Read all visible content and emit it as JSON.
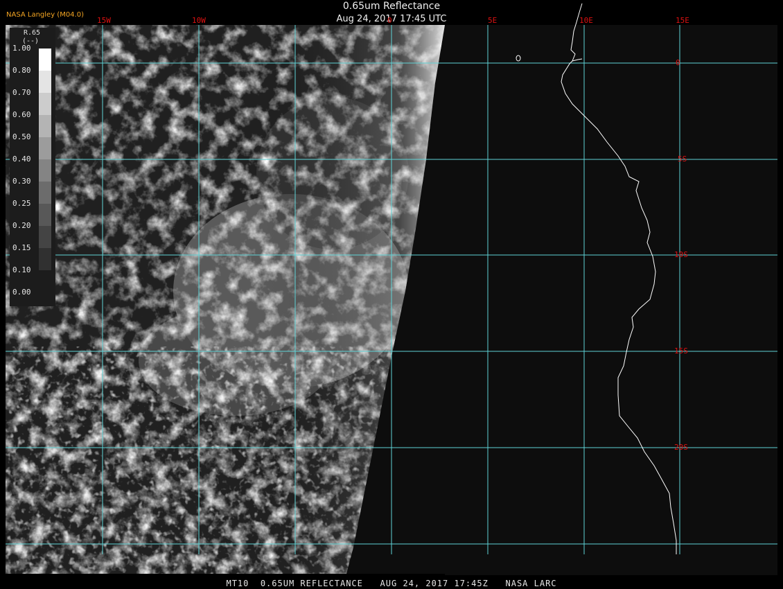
{
  "header": {
    "title": "0.65um Reflectance",
    "subtitle": "Aug 24, 2017 17:45 UTC",
    "org_label": "NASA Langley (M04.0)"
  },
  "legend": {
    "variable": "R.65",
    "unit": "(--)",
    "ticks": [
      "1.00",
      "0.80",
      "0.70",
      "0.60",
      "0.50",
      "0.40",
      "0.30",
      "0.25",
      "0.20",
      "0.15",
      "0.10",
      "0.00"
    ],
    "colors": [
      "#ffffff",
      "#e4e4e4",
      "#cccccc",
      "#b4b4b4",
      "#9c9c9c",
      "#848484",
      "#6c6c6c",
      "#585858",
      "#444444",
      "#303030",
      "#1c1c1c"
    ]
  },
  "grid": {
    "longitudes": [
      "15W",
      "10W",
      "0",
      "5E",
      "10E",
      "15E"
    ],
    "latitudes": [
      "0",
      "5S",
      "10S",
      "15S",
      "20S"
    ]
  },
  "footer": {
    "text": "MT10  0.65UM REFLECTANCE   AUG 24, 2017 17:45Z   NASA LARC"
  },
  "colors": {
    "grid": "#5fd3d6",
    "labels": "#d11111",
    "coast": "#ffffff",
    "org": "#f5a623"
  }
}
